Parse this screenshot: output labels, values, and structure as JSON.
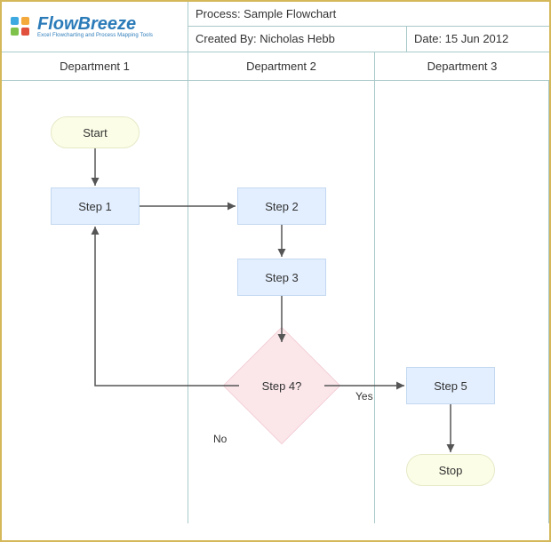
{
  "logo": {
    "title": "FlowBreeze",
    "subtitle": "Excel Flowcharting and Process Mapping Tools"
  },
  "header": {
    "process_label": "Process: Sample Flowchart",
    "created_by": "Created By: Nicholas Hebb",
    "date": "Date: 15 Jun 2012"
  },
  "columns": {
    "col1": "Department 1",
    "col2": "Department 2",
    "col3": "Department 3"
  },
  "nodes": {
    "start": "Start",
    "step1": "Step 1",
    "step2": "Step 2",
    "step3": "Step 3",
    "step4": "Step 4?",
    "step5": "Step 5",
    "stop": "Stop"
  },
  "edges": {
    "no": "No",
    "yes": "Yes"
  },
  "colors": {
    "border": "#d4b85a",
    "grid": "#a9c9c9",
    "terminator": "#fbfde6",
    "process": "#e3efff",
    "decision": "#fbe6ea"
  }
}
